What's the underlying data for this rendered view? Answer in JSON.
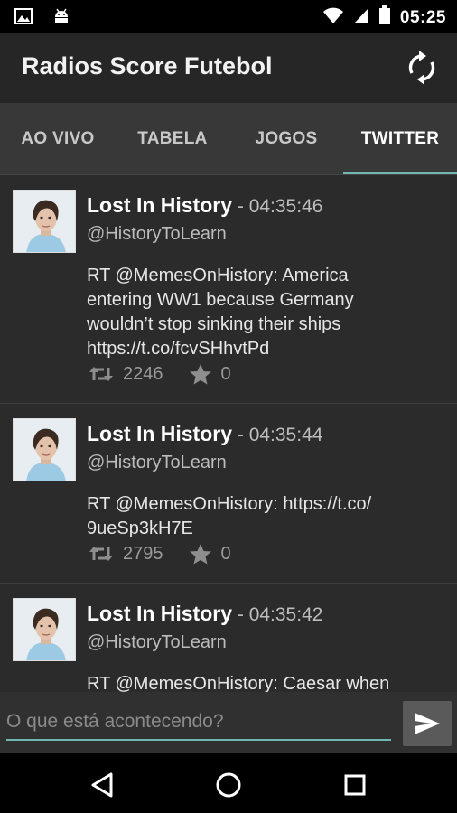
{
  "status_bar": {
    "time": "05:25",
    "left_icons": [
      "image-icon",
      "android-icon"
    ],
    "right_icons": [
      "wifi-icon",
      "signal-icon",
      "battery-icon"
    ]
  },
  "app": {
    "title": "Radios Score Futebol",
    "refresh_icon": "refresh-icon"
  },
  "tabs": [
    {
      "label": "AO VIVO",
      "active": false
    },
    {
      "label": "TABELA",
      "active": false
    },
    {
      "label": "JOGOS",
      "active": false
    },
    {
      "label": "TWITTER",
      "active": true
    }
  ],
  "tweets": [
    {
      "name": "Lost In History",
      "separator": " - ",
      "time": "04:35:46",
      "handle": "@HistoryToLearn",
      "text_lines": [
        "RT @MemesOnHistory: America",
        "entering WW1 because Germany",
        "wouldn’t stop sinking their ships",
        "https://t.co/fcvSHhvtPd"
      ],
      "retweets": "2246",
      "favorites": "0"
    },
    {
      "name": "Lost In History",
      "separator": " - ",
      "time": "04:35:44",
      "handle": "@HistoryToLearn",
      "text_lines": [
        "RT @MemesOnHistory: https://t.co/",
        "9ueSp3kH7E"
      ],
      "retweets": "2795",
      "favorites": "0"
    },
    {
      "name": "Lost In History",
      "separator": " - ",
      "time": "04:35:42",
      "handle": "@HistoryToLearn",
      "text_lines": [
        "RT @MemesOnHistory: Caesar when"
      ],
      "retweets": "",
      "favorites": ""
    }
  ],
  "compose": {
    "placeholder": "O que está acontecendo?",
    "value": "",
    "send_icon": "send-icon"
  },
  "nav": {
    "icons": [
      "back-icon",
      "home-icon",
      "recents-icon"
    ]
  },
  "colors": {
    "accent": "#6fb7b1",
    "background": "#2b2b2b",
    "tab_bar": "#383838",
    "app_bar": "#262626"
  }
}
